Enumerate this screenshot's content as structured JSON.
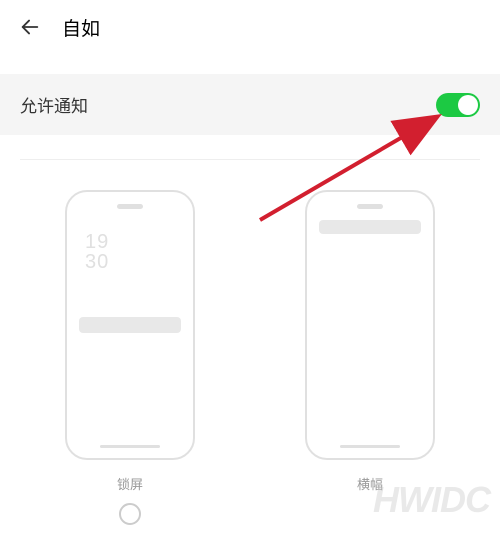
{
  "header": {
    "title": "自如"
  },
  "toggle": {
    "label": "允许通知",
    "enabled": true
  },
  "previews": {
    "lockscreen": {
      "label": "锁屏",
      "time_top": "19",
      "time_bottom": "30"
    },
    "banner": {
      "label": "横幅"
    }
  },
  "watermark": {
    "main": "HWIDC",
    "sub": "          "
  },
  "colors": {
    "toggle_on": "#1cc943",
    "arrow": "#d21f2f"
  }
}
